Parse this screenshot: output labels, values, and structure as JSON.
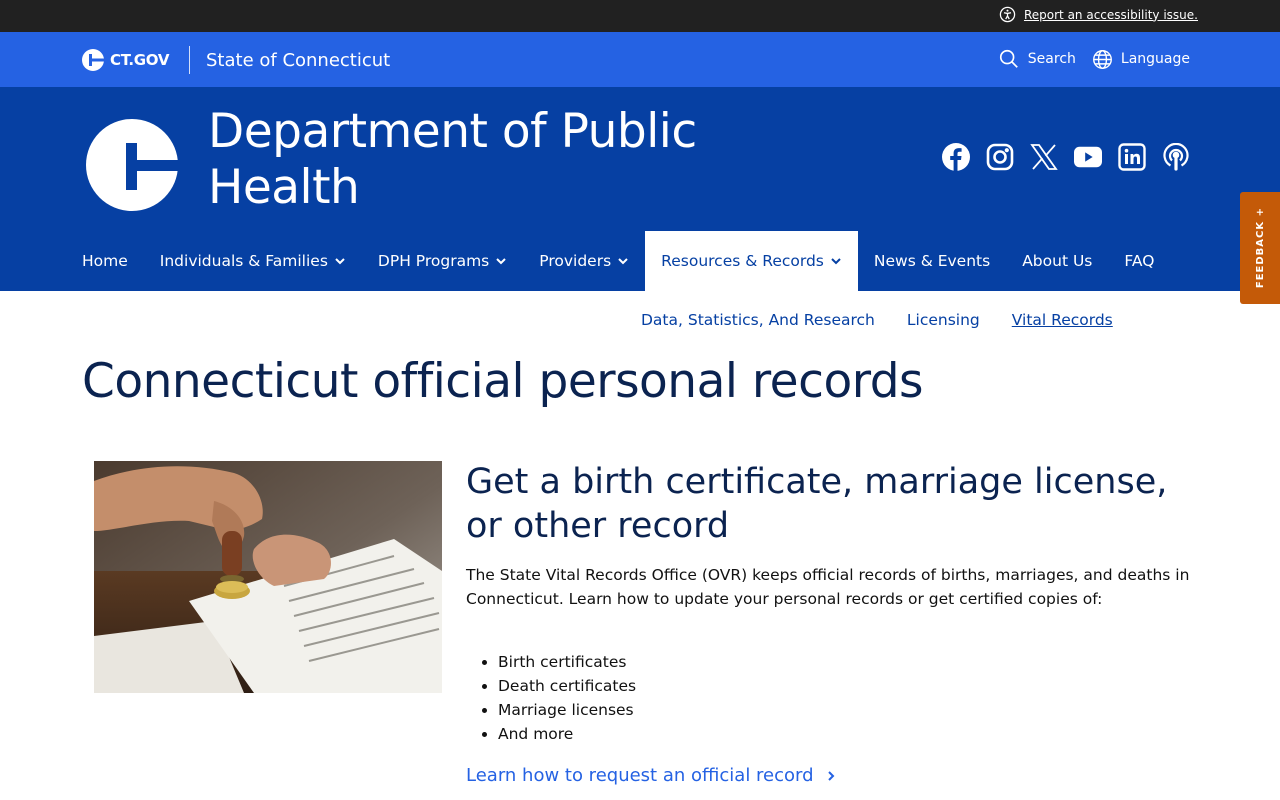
{
  "topbar": {
    "accessibility_label": "Report an accessibility issue."
  },
  "ctbar": {
    "logo_text": "CT.GOV",
    "state_label": "State of Connecticut",
    "search_label": "Search",
    "language_label": "Language"
  },
  "header": {
    "title_line1": "Department of Public",
    "title_line2": "Health",
    "social_icons": [
      "facebook-icon",
      "instagram-icon",
      "x-icon",
      "youtube-icon",
      "linkedin-icon",
      "podcast-icon"
    ]
  },
  "nav": {
    "items": [
      {
        "label": "Home",
        "dropdown": false
      },
      {
        "label": "Individuals & Families",
        "dropdown": true
      },
      {
        "label": "DPH Programs",
        "dropdown": true
      },
      {
        "label": "Providers",
        "dropdown": true
      },
      {
        "label": "Resources & Records",
        "dropdown": true,
        "active": true
      },
      {
        "label": "News & Events",
        "dropdown": false
      },
      {
        "label": "About Us",
        "dropdown": false
      },
      {
        "label": "FAQ",
        "dropdown": false
      }
    ]
  },
  "subnav": {
    "items": [
      "Data, Statistics, And Research",
      "Licensing",
      "Vital Records"
    ]
  },
  "main": {
    "page_title": "Connecticut official personal records",
    "card": {
      "title": "Get a birth certificate, marriage license, or other record",
      "description": "The State Vital Records Office (OVR) keeps official records of births, marriages, and deaths in Connecticut.  Learn how to update your personal records or get certified copies of:",
      "list": [
        "Birth certificates",
        "Death certificates",
        "Marriage licenses",
        "And more"
      ],
      "link_label": "Learn how to request an official record"
    }
  },
  "feedback": {
    "label": "FEEDBACK +"
  },
  "colors": {
    "topbar": "#212121",
    "ctbar": "#2562e3",
    "header": "#0640a3",
    "title": "#0b2350",
    "feedback": "#c45a08"
  }
}
